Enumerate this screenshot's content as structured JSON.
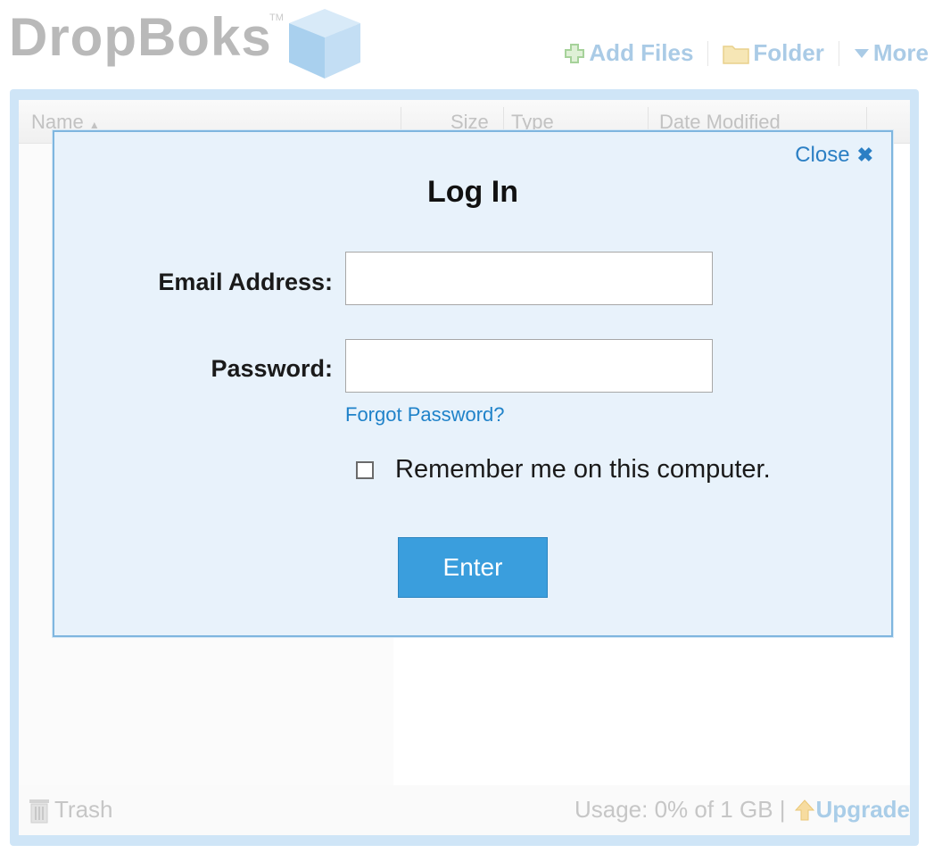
{
  "header": {
    "logo_text": "DropBoks",
    "logo_tm": "TM",
    "toolbar": {
      "add_files": "Add Files",
      "folder": "Folder",
      "more": "More"
    }
  },
  "browser": {
    "columns": {
      "name": "Name",
      "size": "Size",
      "type": "Type",
      "date_modified": "Date Modified"
    },
    "footer": {
      "trash": "Trash",
      "usage": "Usage: 0% of 1 GB |",
      "upgrade": "Upgrade"
    }
  },
  "modal": {
    "close_label": "Close",
    "close_symbol": "✖",
    "title": "Log In",
    "email_label": "Email Address:",
    "email_value": "",
    "password_label": "Password:",
    "password_value": "",
    "forgot_password": "Forgot Password?",
    "remember_label": "Remember me on this computer.",
    "remember_checked": false,
    "enter_label": "Enter"
  },
  "colors": {
    "accent_blue": "#3a9edd",
    "link_blue": "#1f82c9",
    "frame_blue": "#cfe5f7",
    "modal_bg": "#e8f2fb"
  },
  "icons": [
    "cube-logo-icon",
    "plus-icon",
    "folder-icon",
    "chevron-down-icon",
    "close-icon",
    "trash-icon",
    "arrow-up-icon"
  ]
}
